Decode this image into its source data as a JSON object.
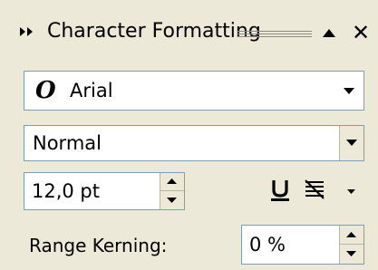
{
  "panel": {
    "title": "Character Formatting",
    "icons": [
      "collapse-icon",
      "move-up-icon",
      "close-icon"
    ]
  },
  "font": {
    "icon": "opentype-font-icon",
    "icon_glyph": "O",
    "value": "Arial"
  },
  "font_style": {
    "value": "Normal"
  },
  "font_size": {
    "value": "12,0 pt"
  },
  "text_decoration": {
    "icons": [
      "underline-icon",
      "strikethrough-icon"
    ],
    "close_glyph": "✕"
  },
  "range_kerning": {
    "label": "Range Kerning:",
    "value": "0 %"
  }
}
